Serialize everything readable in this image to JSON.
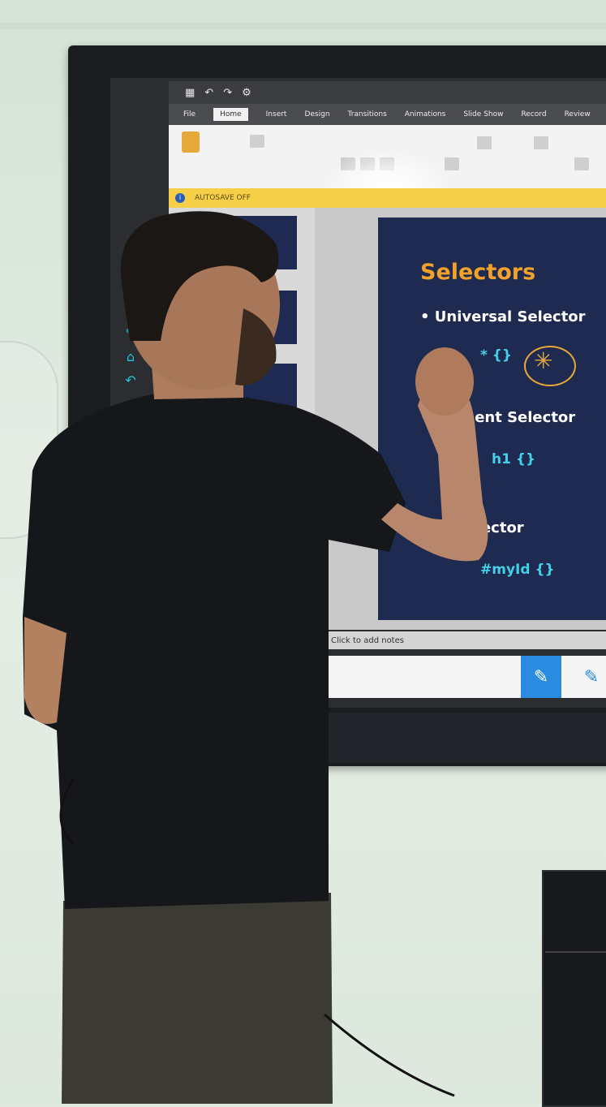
{
  "ppt": {
    "ribbon_tabs": [
      "File",
      "Home",
      "Insert",
      "Design",
      "Transitions",
      "Animations",
      "Slide Show",
      "Record",
      "Review"
    ],
    "notice_text": "AUTOSAVE OFF",
    "notes_placeholder": "Click to add notes"
  },
  "slide": {
    "title": "Selectors",
    "bullet_1": "• Universal Selector",
    "code_1": "* {}",
    "bullet_2": "• Element Selector",
    "code_2": "h1 {}",
    "bullet_3": "• Id Selector",
    "code_3": "#myId {}"
  },
  "colors": {
    "slide_bg": "#1e2a4f",
    "title": "#f2a12b",
    "code": "#42d1e8",
    "notice": "#f4cf47",
    "pen_active": "#2a8be0"
  },
  "icons": {
    "side_tools": [
      "select-icon",
      "pen-icon",
      "home-icon",
      "undo-icon"
    ],
    "pen": "pen-icon"
  }
}
